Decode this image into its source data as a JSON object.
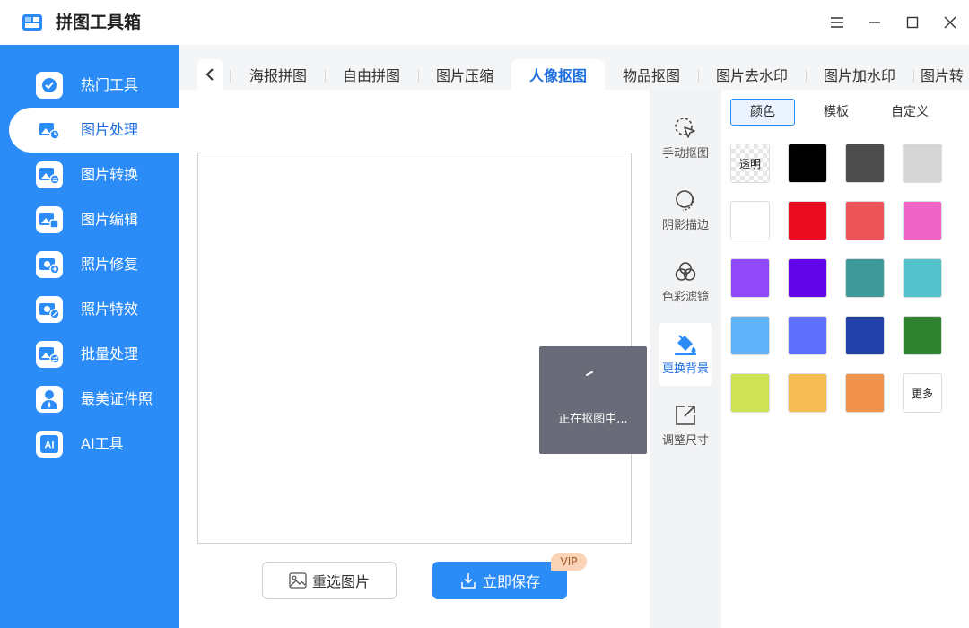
{
  "app": {
    "title": "拼图工具箱"
  },
  "sidebar": {
    "items": [
      {
        "label": "热门工具",
        "icon": "hot-tools-icon"
      },
      {
        "label": "图片处理",
        "icon": "image-process-icon",
        "active": true
      },
      {
        "label": "图片转换",
        "icon": "image-convert-icon"
      },
      {
        "label": "图片编辑",
        "icon": "image-edit-icon"
      },
      {
        "label": "照片修复",
        "icon": "photo-repair-icon"
      },
      {
        "label": "照片特效",
        "icon": "photo-effect-icon"
      },
      {
        "label": "批量处理",
        "icon": "batch-process-icon"
      },
      {
        "label": "最美证件照",
        "icon": "id-photo-icon"
      },
      {
        "label": "AI工具",
        "icon": "ai-tools-icon"
      }
    ]
  },
  "tabs": {
    "items": [
      {
        "label": "海报拼图"
      },
      {
        "label": "自由拼图"
      },
      {
        "label": "图片压缩"
      },
      {
        "label": "人像抠图",
        "active": true
      },
      {
        "label": "物品抠图"
      },
      {
        "label": "图片去水印"
      },
      {
        "label": "图片加水印"
      },
      {
        "label": "图片转"
      }
    ]
  },
  "canvas": {
    "loading_text": "正在抠图中..."
  },
  "actions": {
    "reselect_label": "重选图片",
    "save_label": "立即保存",
    "vip_label": "VIP"
  },
  "tools": {
    "items": [
      {
        "label": "手动抠图",
        "icon": "manual-cutout-icon"
      },
      {
        "label": "阴影描边",
        "icon": "shadow-outline-icon"
      },
      {
        "label": "色彩滤镜",
        "icon": "color-filter-icon"
      },
      {
        "label": "更换背景",
        "icon": "paint-bucket-icon",
        "active": true
      },
      {
        "label": "调整尺寸",
        "icon": "resize-icon"
      }
    ]
  },
  "background_panel": {
    "tabs": [
      {
        "label": "颜色",
        "active": true
      },
      {
        "label": "模板"
      },
      {
        "label": "自定义"
      }
    ],
    "transparent_label": "透明",
    "more_label": "更多",
    "colors": [
      "#000000",
      "#4d4d4d",
      "#d6d6d6",
      "#ffffff",
      "#ec0c22",
      "#ec5359",
      "#f064c8",
      "#9049f6",
      "#6205e8",
      "#3f9998",
      "#53c1c9",
      "#5eb3f9",
      "#5f6ffe",
      "#2241a9",
      "#2f8230",
      "#cde255",
      "#f6bd55",
      "#f0924a"
    ]
  },
  "accent_color": "#2b8cf8"
}
